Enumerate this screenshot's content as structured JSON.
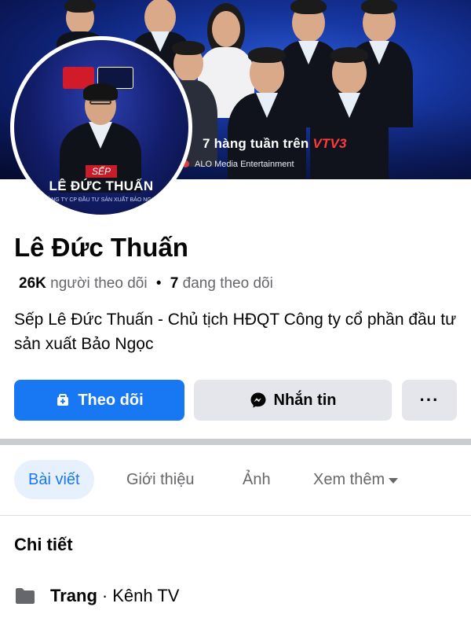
{
  "cover": {
    "tagline_prefix": "7 hàng tuần trên ",
    "tagline_channel": "VTV3",
    "organization": "ALO Media Entertainment"
  },
  "avatar": {
    "role": "SẾP",
    "name": "LÊ ĐỨC THUẤN",
    "company": "CÔNG TY CP ĐẦU TƯ SẢN XUẤT BẢO NGỌC"
  },
  "profile": {
    "name": "Lê Đức Thuấn",
    "followers_count": "26K",
    "followers_label": "người theo dõi",
    "separator": "•",
    "following_count": "7",
    "following_label": "đang theo dõi",
    "bio": "Sếp Lê Đức Thuấn - Chủ tịch HĐQT Công ty cổ phần đầu tư sản xuất Bảo Ngọc"
  },
  "actions": {
    "follow_label": "Theo dõi",
    "message_label": "Nhắn tin",
    "more_label": "···"
  },
  "tabs": [
    {
      "label": "Bài viết",
      "active": true
    },
    {
      "label": "Giới thiệu",
      "active": false
    },
    {
      "label": "Ảnh",
      "active": false
    },
    {
      "label": "Xem thêm",
      "active": false
    }
  ],
  "details": {
    "title": "Chi tiết",
    "page_type_label": "Trang",
    "dot": "·",
    "page_category": "Kênh TV"
  },
  "colors": {
    "accent": "#1877f2",
    "secondary_button": "#e4e6eb",
    "muted_text": "#65676b"
  }
}
